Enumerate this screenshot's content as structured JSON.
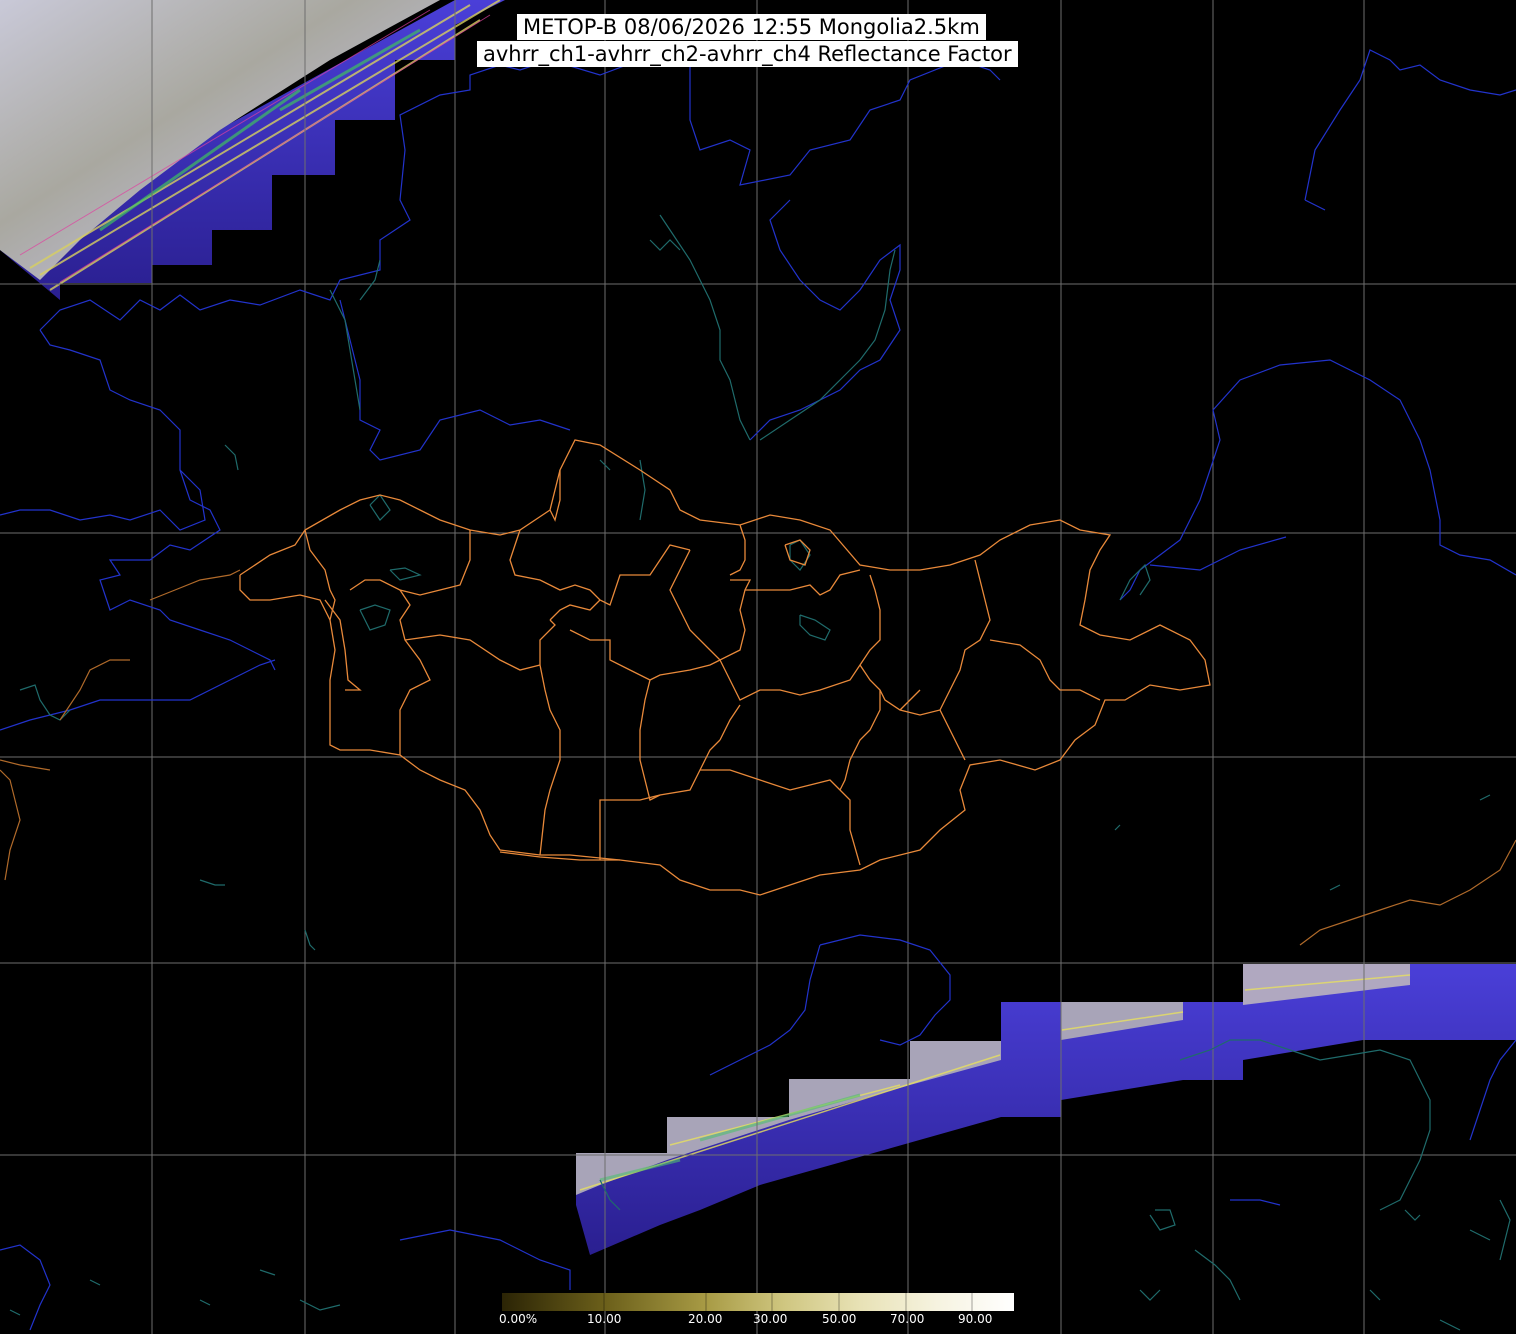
{
  "title": {
    "line1": "METOP-B 08/06/2026 12:55 Mongolia2.5km",
    "line2": "avhrr_ch1-avhrr_ch2-avhrr_ch4 Reflectance Factor"
  },
  "colorbar": {
    "labels": [
      "0.00%",
      "10.00",
      "20.00",
      "30.00",
      "50.00",
      "70.00",
      "90.00"
    ],
    "colors": [
      "#2b2405",
      "#6b5f1a",
      "#a89b45",
      "#cfc680",
      "#e8e2b6",
      "#f6f3e0",
      "#ffffff"
    ]
  },
  "colors": {
    "grid": "#6e6e6e",
    "country_border": "#2233cc",
    "province_border": "#e8893a",
    "river": "#1f6b6b",
    "swath_water": "#3a2fb0"
  },
  "icons": {
    "map": "satellite-map"
  }
}
